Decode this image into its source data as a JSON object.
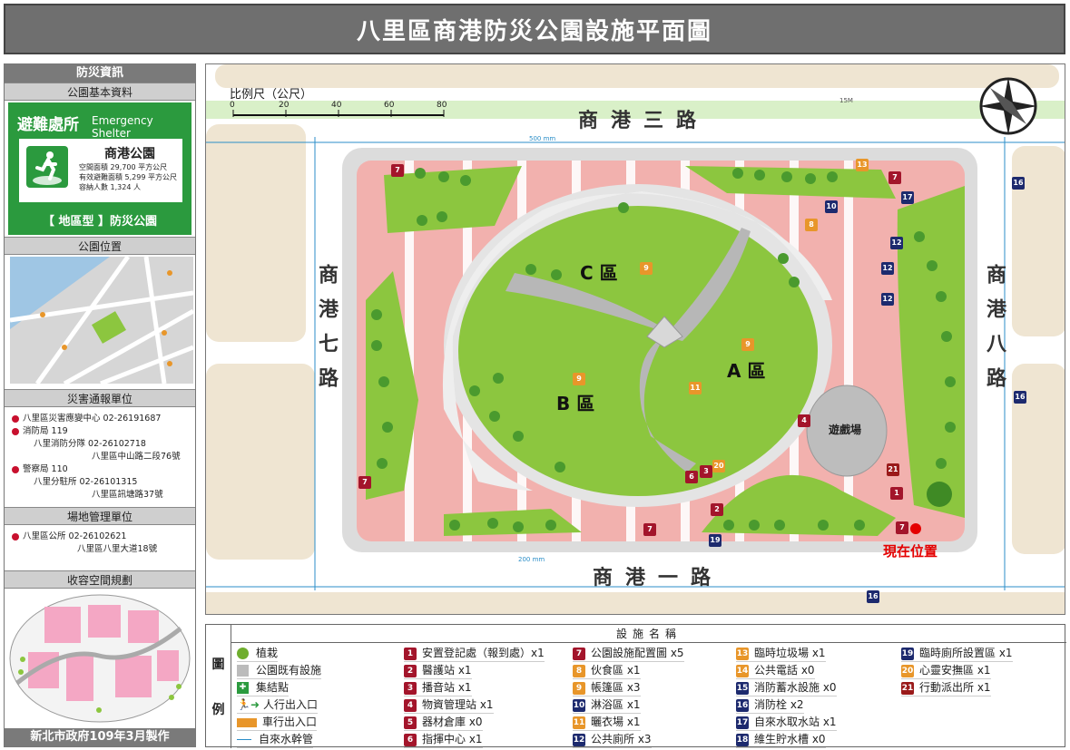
{
  "title": "八里區商港防災公園設施平面圖",
  "sidebar": {
    "h_disaster": "防災資訊",
    "h_basic": "公園基本資料",
    "shelter_zh": "避難處所",
    "shelter_en": "Emergency Shelter",
    "park_name": "商港公園",
    "space_area": "空間面積 29,700 平方公尺",
    "effective_area": "有效避難面積 5,299 平方公尺",
    "capacity": "容納人數 1,324 人",
    "park_type": "【 地區型 】防災公園",
    "h_location": "公園位置",
    "h_report": "災害通報單位",
    "report": [
      {
        "name": "八里區災害應變中心",
        "phone": "02-26191687"
      },
      {
        "name": "消防局",
        "phone": "119"
      },
      {
        "name": "八里消防分隊",
        "phone": "02-26102718"
      },
      {
        "name": "八里區中山路二段76號",
        "phone": ""
      },
      {
        "name": "警察局",
        "phone": "110"
      },
      {
        "name": "八里分駐所",
        "phone": "02-26101315"
      },
      {
        "name": "八里區訊塘路37號",
        "phone": ""
      }
    ],
    "h_manage": "場地管理單位",
    "manage": [
      {
        "name": "八里區公所",
        "phone": "02-26102621"
      },
      {
        "name": "八里區八里大道18號",
        "phone": ""
      }
    ],
    "h_capacity": "收容空間規劃",
    "footer": "新北市政府109年3月製作"
  },
  "map": {
    "scale_label": "比例尺（公尺）",
    "scale_ticks": [
      "0",
      "20",
      "40",
      "60",
      "80"
    ],
    "road_north": "商港三路",
    "road_south": "商港一路",
    "road_west": "商港七路",
    "road_east": "商港八路",
    "zone_a": "A 區",
    "zone_b": "B 區",
    "zone_c": "C 區",
    "playground": "遊戲場",
    "you_are_here": "現在位置",
    "dim_500": "500 mm",
    "dim_200": "200 mm",
    "dim_15m": "15M"
  },
  "legend": {
    "title": "設施名稱",
    "side_top": "圖",
    "side_bottom": "例",
    "basic": [
      "植栽",
      "公園既有設施",
      "集結點",
      "人行出入口",
      "車行出入口",
      "自來水幹管"
    ],
    "facilities": [
      {
        "n": "1",
        "label": "安置登記處（報到處）x1",
        "color": "red"
      },
      {
        "n": "2",
        "label": "醫護站 x1",
        "color": "red"
      },
      {
        "n": "3",
        "label": "播音站 x1",
        "color": "red"
      },
      {
        "n": "4",
        "label": "物資管理站 x1",
        "color": "red"
      },
      {
        "n": "5",
        "label": "器材倉庫 x0",
        "color": "red"
      },
      {
        "n": "6",
        "label": "指揮中心 x1",
        "color": "red"
      },
      {
        "n": "7",
        "label": "公園設施配置圖 x5",
        "color": "red"
      },
      {
        "n": "8",
        "label": "伙食區 x1",
        "color": "org"
      },
      {
        "n": "9",
        "label": "帳篷區 x3",
        "color": "org"
      },
      {
        "n": "10",
        "label": "淋浴區 x1",
        "color": "navy"
      },
      {
        "n": "11",
        "label": "曬衣場 x1",
        "color": "org"
      },
      {
        "n": "12",
        "label": "公共廁所 x3",
        "color": "navy"
      },
      {
        "n": "13",
        "label": "臨時垃圾場 x1",
        "color": "org"
      },
      {
        "n": "14",
        "label": "公共電話 x0",
        "color": "org"
      },
      {
        "n": "15",
        "label": "消防蓄水設施 x0",
        "color": "navy"
      },
      {
        "n": "16",
        "label": "消防栓 x2",
        "color": "navy"
      },
      {
        "n": "17",
        "label": "自來水取水站 x1",
        "color": "navy"
      },
      {
        "n": "18",
        "label": "維生貯水槽 x0",
        "color": "navy"
      },
      {
        "n": "19",
        "label": "臨時廁所設置區 x1",
        "color": "navy"
      },
      {
        "n": "20",
        "label": "心靈安撫區 x1",
        "color": "org"
      },
      {
        "n": "21",
        "label": "行動派出所 x1",
        "color": "brn"
      }
    ]
  }
}
